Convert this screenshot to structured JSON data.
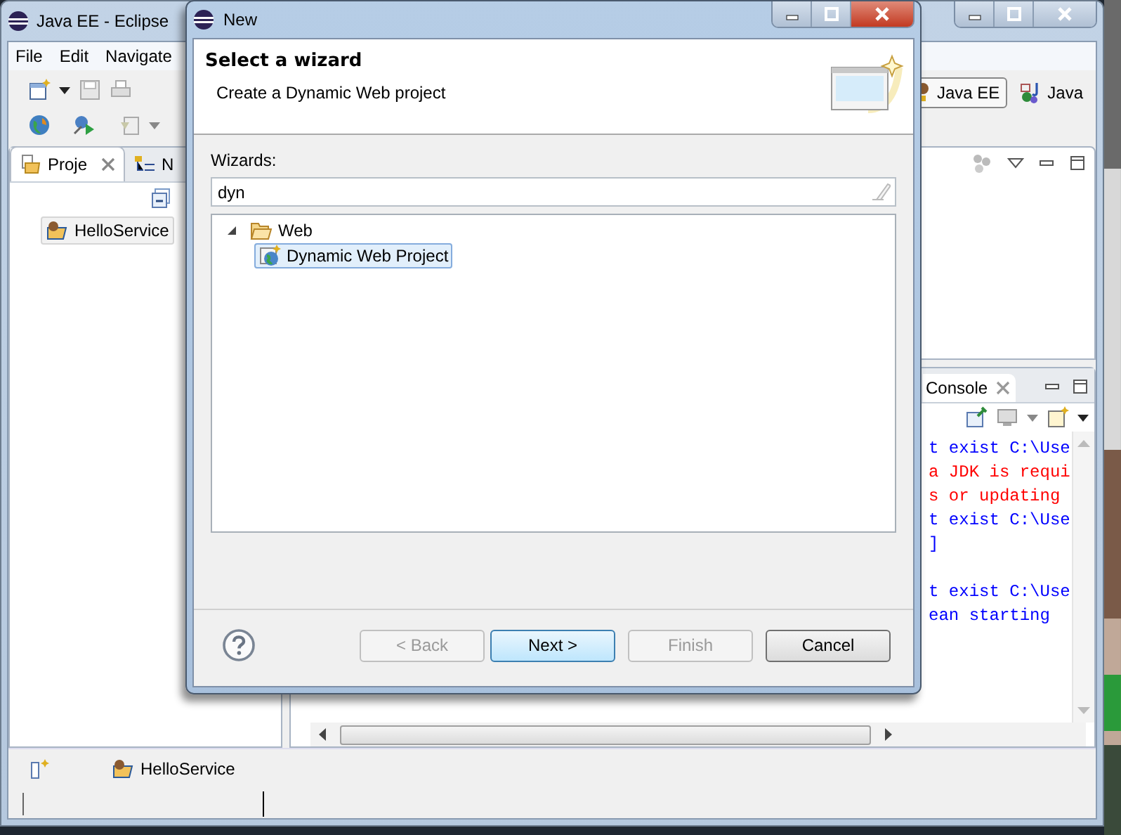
{
  "window": {
    "title": "Java EE - Eclipse"
  },
  "menu": [
    "File",
    "Edit",
    "Navigate"
  ],
  "perspectives": [
    {
      "label": "Java EE",
      "selected": true
    },
    {
      "label": "Java",
      "selected": false
    }
  ],
  "project_explorer": {
    "tabs": [
      {
        "label": "Proje",
        "selected": true
      },
      {
        "label": "N",
        "selected": false
      }
    ],
    "items": [
      {
        "label": "HelloService",
        "selected": true
      }
    ]
  },
  "console": {
    "tab": "Console",
    "blocks": [
      {
        "lines": [
          {
            "text": "t exist C:\\Use",
            "kind": "info"
          },
          {
            "text": "a JDK is requi",
            "kind": "error"
          },
          {
            "text": "s or updating",
            "kind": "error"
          },
          {
            "text": "t exist C:\\Use",
            "kind": "info"
          },
          {
            "text": "]",
            "kind": "info"
          }
        ]
      },
      {
        "lines": [
          {
            "text": "t exist C:\\Use",
            "kind": "info"
          },
          {
            "text": "ean starting",
            "kind": "info"
          }
        ]
      }
    ]
  },
  "status_bar": {
    "selection": "HelloService"
  },
  "dialog": {
    "title": "New",
    "heading": "Select a wizard",
    "description": "Create a Dynamic Web project",
    "filter_label": "Wizards:",
    "filter": {
      "value": "dyn"
    },
    "tree": [
      {
        "label": "Web",
        "expanded": true,
        "children": [
          {
            "label": "Dynamic Web Project",
            "selected": true
          }
        ]
      }
    ],
    "buttons": [
      {
        "label": "< Back",
        "disabled": true,
        "default": false
      },
      {
        "label": "Next >",
        "disabled": false,
        "default": true
      },
      {
        "label": "Finish",
        "disabled": true,
        "default": false
      },
      {
        "label": "Cancel",
        "disabled": false,
        "default": false
      }
    ]
  }
}
